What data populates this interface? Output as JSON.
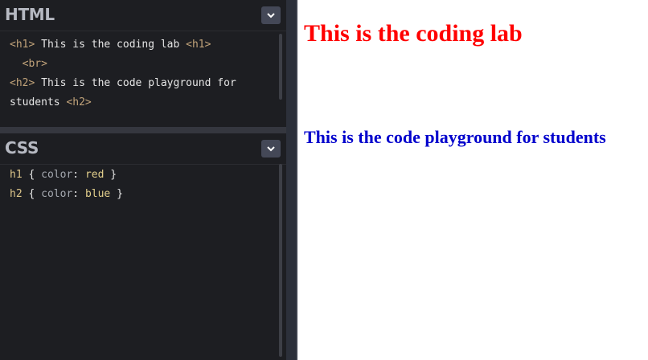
{
  "html_panel": {
    "title": "HTML",
    "lines": [
      {
        "t1": "<h1>",
        "text": " This is the coding lab ",
        "t2": "<h1>"
      },
      {
        "indent": "  ",
        "t1": "<br>"
      },
      {
        "t1": "<h2>",
        "text": " This is the code playground for"
      },
      {
        "text": "students ",
        "t2": "<h2>"
      }
    ]
  },
  "css_panel": {
    "title": "CSS",
    "rules": [
      {
        "selector": "h1",
        "open": " { ",
        "property": "color",
        "colon": ": ",
        "value": "red",
        "close": " }"
      },
      {
        "selector": "h2",
        "open": " { ",
        "property": "color",
        "colon": ": ",
        "value": "blue",
        "close": " }"
      }
    ]
  },
  "preview": {
    "h1_text": "This is the coding lab",
    "h1_color": "#ff0000",
    "h2_text": "This is the code playground for students",
    "h2_color": "#0000cc"
  },
  "colors": {
    "editor_bg": "#1d1e22",
    "tag": "#c1a37a",
    "button_bg": "#444857"
  },
  "icons": {
    "panel_toggle": "chevron-down-icon"
  }
}
